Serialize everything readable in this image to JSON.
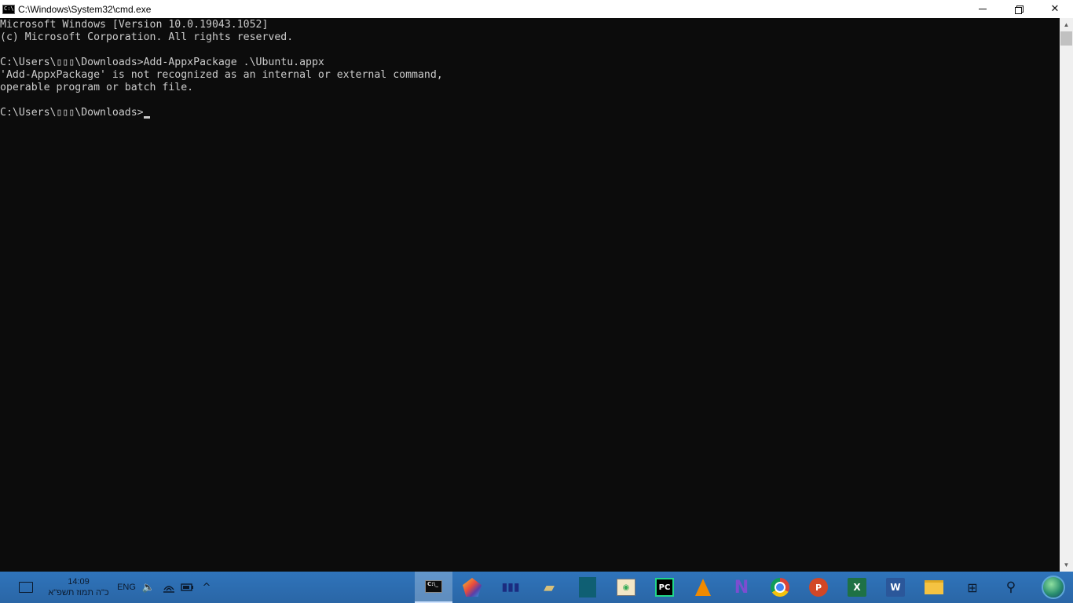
{
  "window": {
    "title": "C:\\Windows\\System32\\cmd.exe",
    "icon": "cmd-icon",
    "controls": {
      "minimize": "minimize-icon",
      "restore": "restore-icon",
      "close": "✕"
    }
  },
  "console": {
    "lines": [
      "Microsoft Windows [Version 10.0.19043.1052]",
      "(c) Microsoft Corporation. All rights reserved.",
      "",
      "C:\\Users\\▯▯▯\\Downloads>Add-AppxPackage .\\Ubuntu.appx",
      "'Add-AppxPackage' is not recognized as an internal or external command,",
      "operable program or batch file.",
      "",
      "C:\\Users\\▯▯▯\\Downloads>"
    ]
  },
  "scrollbar": {
    "up": "▲",
    "down": "▼"
  },
  "taskbar": {
    "clock": {
      "time": "14:09",
      "date": "כ\"ה תמוז תשפ\"א"
    },
    "language": "ENG",
    "tray": {
      "volume": "🔈",
      "network": "wifi-icon",
      "battery": "battery-icon",
      "show_hidden": "^"
    },
    "apps": [
      {
        "name": "command-prompt",
        "active": true
      },
      {
        "name": "pentagon-app",
        "active": false
      },
      {
        "name": "bars-app",
        "active": false
      },
      {
        "name": "file-app",
        "active": false
      },
      {
        "name": "book-app",
        "active": false
      },
      {
        "name": "map-app",
        "active": false
      },
      {
        "name": "pycharm",
        "label": "PC",
        "active": false
      },
      {
        "name": "vlc",
        "active": false
      },
      {
        "name": "visual-studio",
        "label": "N",
        "active": false
      },
      {
        "name": "chrome",
        "active": false
      },
      {
        "name": "powerpoint",
        "label": "P",
        "active": false
      },
      {
        "name": "excel",
        "label": "X",
        "active": false
      },
      {
        "name": "word",
        "label": "W",
        "active": false
      },
      {
        "name": "file-explorer",
        "active": false
      },
      {
        "name": "task-view",
        "label": "⊞",
        "active": false
      },
      {
        "name": "search",
        "label": "⚲",
        "active": false
      }
    ]
  }
}
